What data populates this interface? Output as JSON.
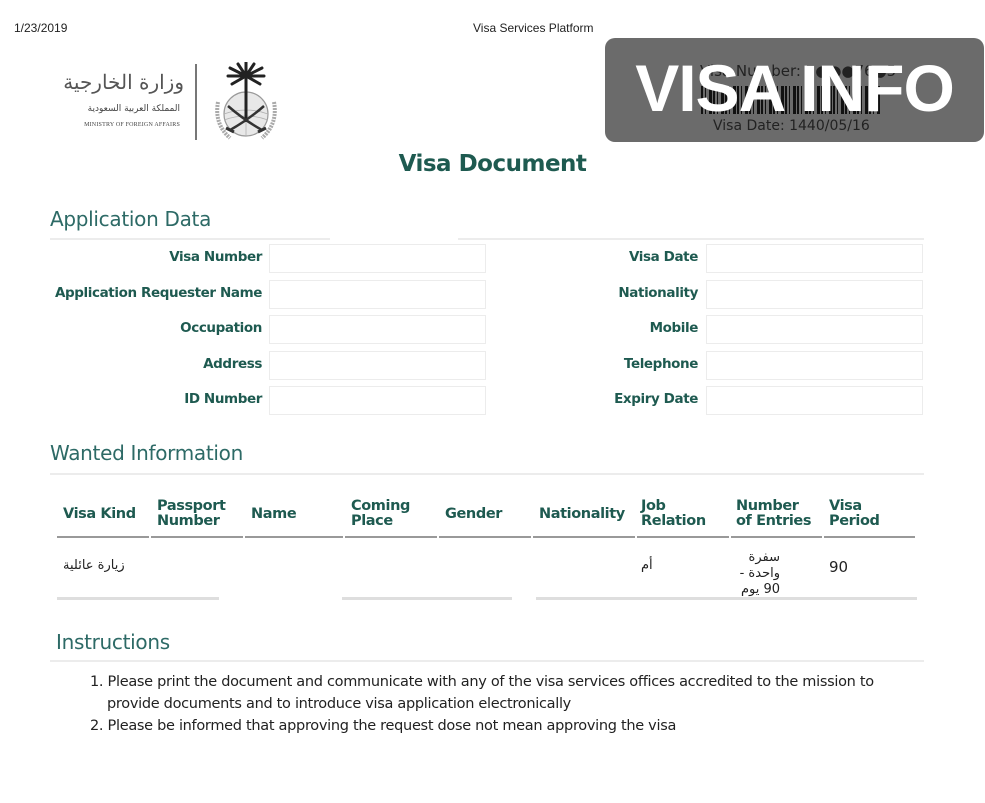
{
  "print_header": {
    "date": "1/23/2019",
    "title": "Visa Services Platform"
  },
  "logo": {
    "arabic_title": "وزارة الخارجية",
    "arabic_subtitle": "المملكة العربية السعودية",
    "english_name": "MINISTRY OF FOREIGN AFFAIRS",
    "emblem_icon": "saudi-emblem-palm-swords-icon"
  },
  "visa_info_badge": {
    "overlay_text": "VISA INFO",
    "visa_number_text": "Visa Number: 7●●●76●5",
    "visa_date_text": "Visa Date: 1440/05/16",
    "barcode_icon": "barcode-icon"
  },
  "document_title": "Visa Document",
  "application_data": {
    "title": "Application Data",
    "left_fields": [
      {
        "label": "Visa Number",
        "value": ""
      },
      {
        "label": "Application Requester Name",
        "value": ""
      },
      {
        "label": "Occupation",
        "value": ""
      },
      {
        "label": "Address",
        "value": ""
      },
      {
        "label": "ID Number",
        "value": ""
      }
    ],
    "right_fields": [
      {
        "label": "Visa Date",
        "value": ""
      },
      {
        "label": "Nationality",
        "value": ""
      },
      {
        "label": "Mobile",
        "value": ""
      },
      {
        "label": "Telephone",
        "value": ""
      },
      {
        "label": "Expiry Date",
        "value": ""
      }
    ]
  },
  "wanted_information": {
    "title": "Wanted Information",
    "columns": [
      {
        "line1": "Visa Kind",
        "line2": ""
      },
      {
        "line1": "Passport",
        "line2": "Number"
      },
      {
        "line1": "Name",
        "line2": ""
      },
      {
        "line1": "Coming",
        "line2": "Place"
      },
      {
        "line1": "Gender",
        "line2": ""
      },
      {
        "line1": "Nationality",
        "line2": ""
      },
      {
        "line1": "Job",
        "line2": "Relation"
      },
      {
        "line1": "Number",
        "line2": "of Entries"
      },
      {
        "line1": "Visa",
        "line2": "Period"
      }
    ],
    "rows": [
      {
        "visa_kind": "زيارة عائلية",
        "passport_number": "",
        "name": "",
        "coming_place": "",
        "gender": "",
        "nationality": "",
        "job_relation": "أم",
        "number_of_entries_line1": "سفرة واحدة -",
        "number_of_entries_line2": "90 يوم",
        "visa_period": "90"
      }
    ]
  },
  "instructions": {
    "title": "Instructions",
    "items": [
      "1. Please print the document and communicate with any of the visa services offices accredited to the mission to provide documents and to introduce visa application electronically",
      "2. Please be informed that approving the request dose not mean approving the visa"
    ]
  }
}
